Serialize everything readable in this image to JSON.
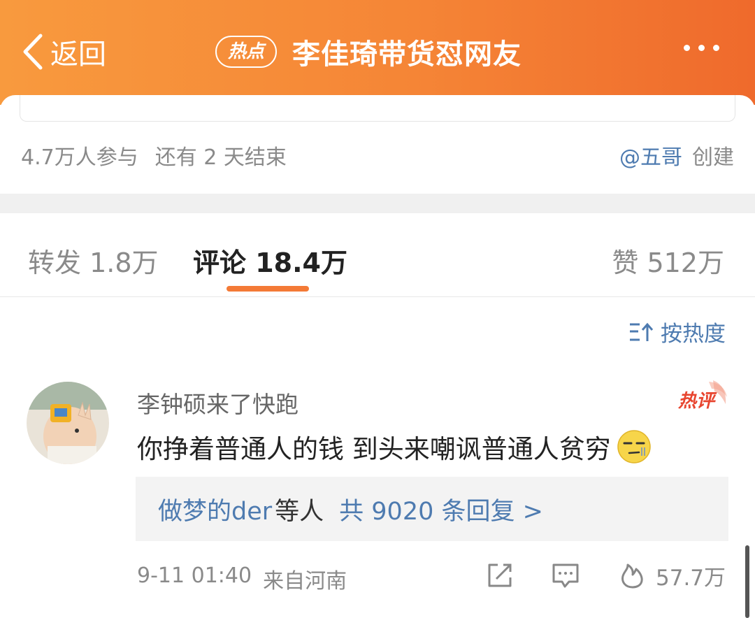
{
  "header": {
    "back_label": "返回",
    "badge": "热点",
    "title": "李佳琦带货怼网友"
  },
  "topic_info": {
    "participants": "4.7万人参与",
    "remaining": "还有 2 天结束",
    "creator_user": "@五哥",
    "creator_suffix": "创建"
  },
  "tabs": [
    {
      "label": "转发 1.8万",
      "active": false
    },
    {
      "label": "评论 18.4万",
      "active": true
    },
    {
      "label": "赞 512万",
      "active": false
    }
  ],
  "sort": {
    "label": "按热度"
  },
  "comment": {
    "username": "李钟硕来了快跑",
    "hot_tag": "热评",
    "text": "你挣着普通人的钱 到头来嘲讽普通人贫穷",
    "reply": {
      "names": "做梦的der",
      "names_suffix": "等人",
      "count_text": "共 9020 条回复 >"
    },
    "time": "9-11 01:40",
    "source": "来自河南",
    "likes": "57.7万"
  },
  "colors": {
    "header_start": "#f89a3e",
    "header_end": "#ef6a2c",
    "link_blue": "#4e7bb0",
    "accent_orange": "#f47a36",
    "hot_red": "#e8452f"
  },
  "icons": {
    "back": "chevron-left-icon",
    "more": "more-dots-icon",
    "sort": "sort-icon",
    "share": "share-icon",
    "comment": "comment-icon",
    "like": "flame-like-icon",
    "emoji": "smirk-emoji-icon"
  }
}
